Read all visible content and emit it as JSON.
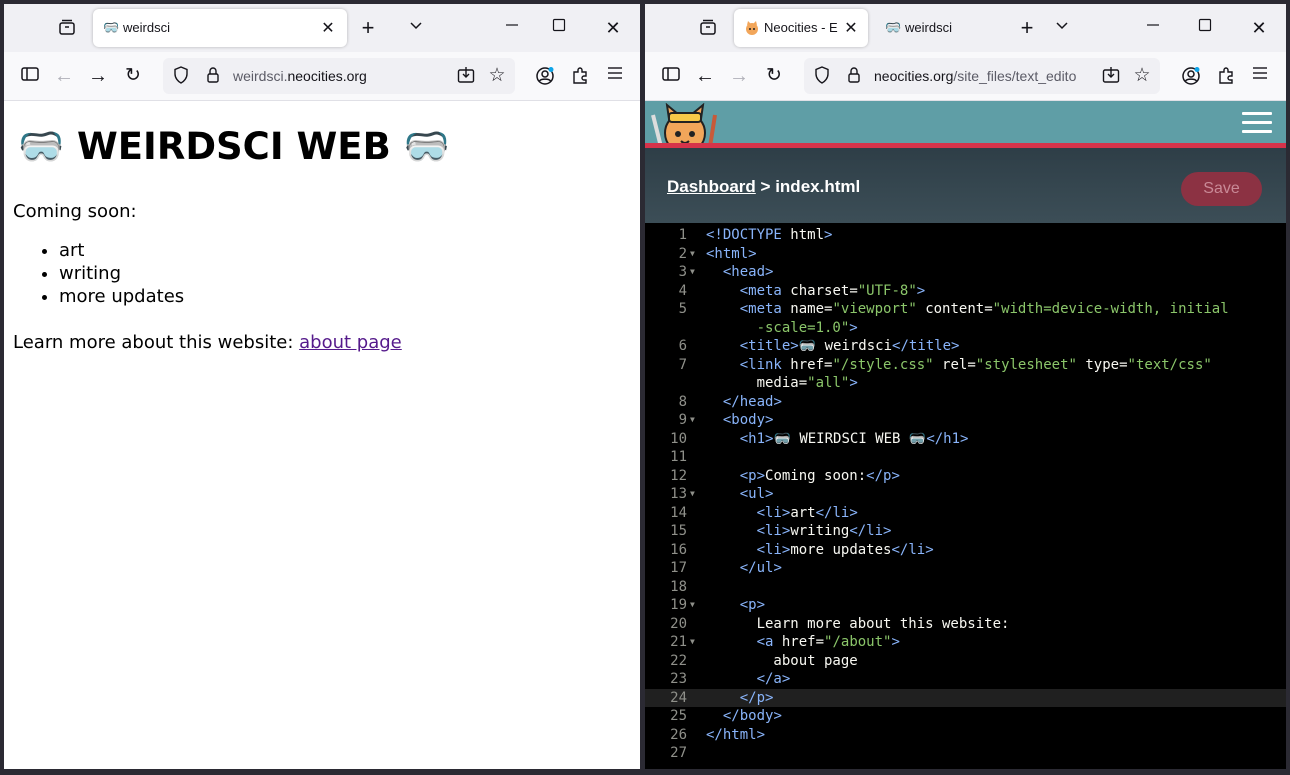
{
  "left_window": {
    "tab": {
      "title": "weirdsci",
      "favicon": "goggles-icon"
    },
    "url": {
      "domain_prefix": "weirdsci.",
      "domain": "neocities.org"
    },
    "page": {
      "heading_emoji": "🥽",
      "heading_text": "WEIRDSCI WEB",
      "intro": "Coming soon:",
      "items": [
        "art",
        "writing",
        "more updates"
      ],
      "learn_more": "Learn more about this website:",
      "link_text": "about page"
    }
  },
  "right_window": {
    "tabs": [
      {
        "title": "Neocities - E",
        "favicon": "neocities-cat-icon"
      },
      {
        "title": "weirdsci",
        "favicon": "goggles-icon"
      }
    ],
    "url": {
      "domain": "neocities.org",
      "path": "/site_files/text_edito"
    },
    "breadcrumb": {
      "dashboard": "Dashboard",
      "separator": ">",
      "file": "index.html"
    },
    "save_label": "Save",
    "code_lines": [
      "<!DOCTYPE html>",
      "<html>",
      "  <head>",
      "    <meta charset=\"UTF-8\">",
      "    <meta name=\"viewport\" content=\"width=device-width, initial",
      "      -scale=1.0\">",
      "    <title>🥽 weirdsci</title>",
      "    <link href=\"/style.css\" rel=\"stylesheet\" type=\"text/css\"",
      "      media=\"all\">",
      "  </head>",
      "  <body>",
      "    <h1>🥽 WEIRDSCI WEB 🥽</h1>",
      "",
      "    <p>Coming soon:</p>",
      "    <ul>",
      "      <li>art</li>",
      "      <li>writing</li>",
      "      <li>more updates</li>",
      "    </ul>",
      "",
      "    <p>",
      "      Learn more about this website:",
      "      <a href=\"/about\">",
      "        about page",
      "      </a>",
      "    </p>",
      "  </body>",
      "</html>",
      ""
    ],
    "line_numbers": [
      "1",
      "2",
      "3",
      "4",
      "5",
      "",
      "6",
      "7",
      "",
      "8",
      "9",
      "10",
      "11",
      "12",
      "13",
      "14",
      "15",
      "16",
      "17",
      "18",
      "19",
      "20",
      "21",
      "22",
      "23",
      "24",
      "25",
      "26",
      "27"
    ],
    "folded_lines": [
      "2",
      "3",
      "9",
      "13",
      "19",
      "21"
    ],
    "active_line": "24"
  },
  "colors": {
    "tag": "#89b4fa",
    "string": "#8bc66a",
    "neocities_header": "#5f9ea6",
    "stripe": "#d6334a",
    "link_visited": "#551a8b"
  }
}
